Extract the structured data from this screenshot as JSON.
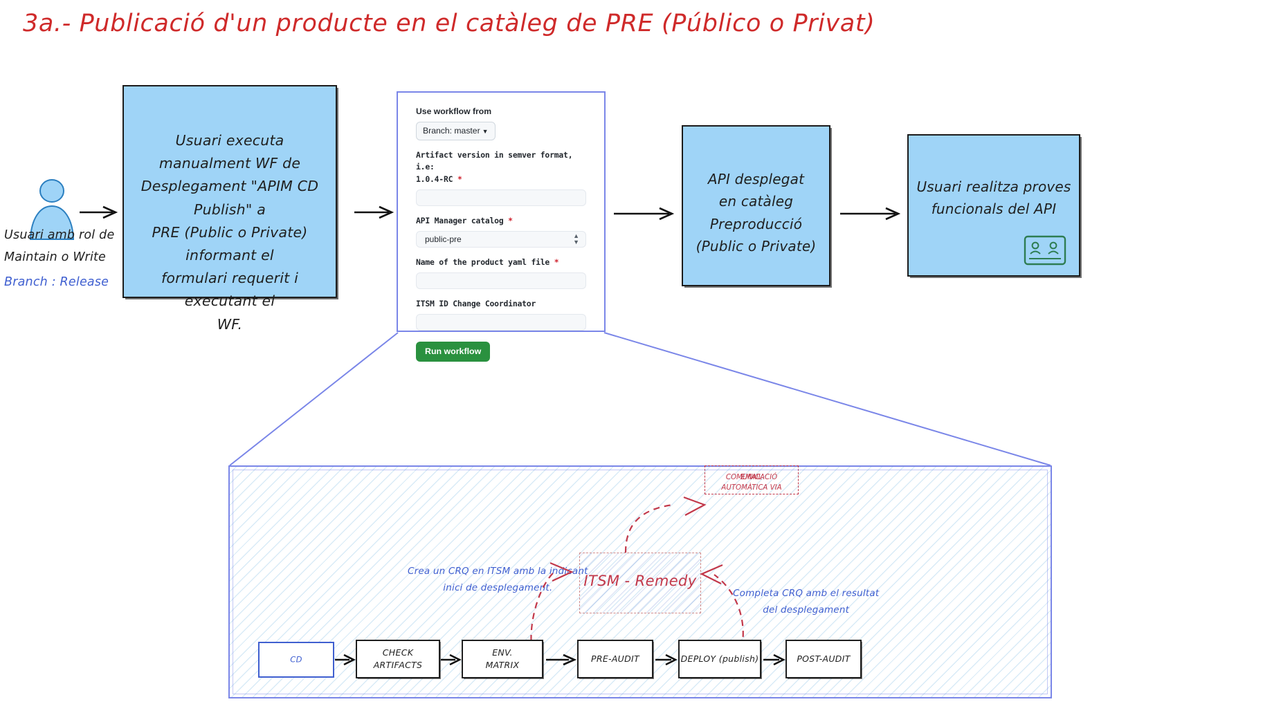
{
  "title": "3a.- Publicació d'un producte en el catàleg de PRE (Público o Privat)",
  "actor": {
    "icon": "user-person-icon",
    "line1": "Usuari amb rol de",
    "line2": "Maintain o Write",
    "line3": "Branch : Release",
    "branch_color": "#3f5fd0"
  },
  "boxes": {
    "step1": {
      "lines": [
        "Usuari executa manualment WF de",
        "Desplegament \"APIM CD Publish\" a",
        "PRE (Public o Private) informant el",
        "formulari requerit i executant el",
        "WF."
      ],
      "fill": "#9fd4f7"
    },
    "step3": {
      "lines": [
        "API desplegat",
        "en catàleg Preproducció",
        "(Public o Private)"
      ],
      "fill": "#9fd4f7"
    },
    "step4": {
      "lines": [
        "Usuari realitza proves",
        "funcionals del API"
      ],
      "fill": "#9fd4f7",
      "icon": "video-conference-icon"
    }
  },
  "form": {
    "use_workflow_from_label": "Use workflow from",
    "branch_button": "Branch: master",
    "branch_caret": "chevron-down-icon",
    "artifact_label_line1": "Artifact version in semver format, i.e:",
    "artifact_label_line2": "1.0.4-RC",
    "artifact_required": "*",
    "artifact_value": "",
    "catalog_label": "API Manager catalog",
    "catalog_required": "*",
    "catalog_value": "public-pre",
    "product_yaml_label": "Name of the product yaml file",
    "product_yaml_required": "*",
    "product_yaml_value": "",
    "itsm_label": "ITSM ID Change Coordinator",
    "itsm_value": "",
    "run_button": "Run workflow",
    "run_button_color": "#2a913f",
    "panel_border_color": "#7a86e8"
  },
  "bottom_panel": {
    "note_left": [
      "Crea un CRQ en ITSM amb la indicant",
      "inici de desplegament."
    ],
    "note_right": [
      "Completa CRQ amb el resultat",
      "del desplegament"
    ],
    "itsm_box": "ITSM - Remedy",
    "email_box": [
      "COMUNICACIÓ AUTOMÀTICA VIA",
      "EMAIL"
    ],
    "stages": [
      {
        "label": "CD",
        "label2": "",
        "first": true
      },
      {
        "label": "CHECK",
        "label2": "ARTIFACTS",
        "first": false
      },
      {
        "label": "ENV.",
        "label2": "MATRIX",
        "first": false
      },
      {
        "label": "PRE-AUDIT",
        "label2": "",
        "first": false
      },
      {
        "label": "DEPLOY (publish)",
        "label2": "",
        "first": false
      },
      {
        "label": "POST-AUDIT",
        "label2": "",
        "first": false
      }
    ]
  }
}
